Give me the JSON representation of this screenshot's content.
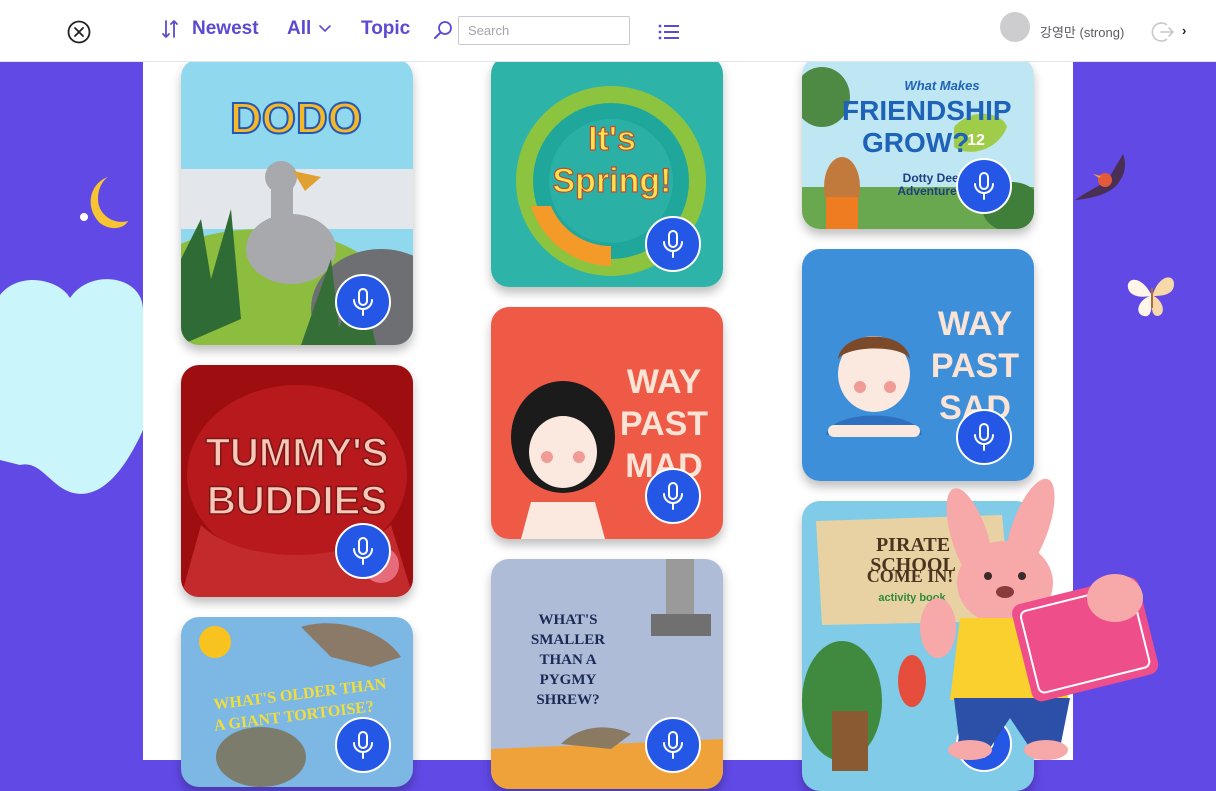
{
  "toolbar": {
    "sort_label": "Newest",
    "filter_label": "All",
    "topic_label": "Topic",
    "search_placeholder": "Search",
    "search_value": ""
  },
  "user": {
    "name": "강영만 (strong)"
  },
  "icons": {
    "close": "close-circle-icon",
    "sort": "sort-arrows-icon",
    "filter": "chevron-down-icon",
    "search": "magnifier-icon",
    "view": "list-view-icon",
    "logout": "logout-icon",
    "next": "chevron-right-icon",
    "mic": "microphone-icon"
  },
  "colors": {
    "accent": "#5b4bd1",
    "background": "#6149e6",
    "mic_button": "#2457e6"
  },
  "books": [
    {
      "title_lines": [
        "DODO"
      ]
    },
    {
      "title_lines": [
        "It's",
        "Spring!"
      ]
    },
    {
      "title_lines": [
        "What Makes",
        "FRIENDSHIP",
        "GROW?",
        "12",
        "Dotty Deer",
        "Adventure"
      ]
    },
    {
      "title_lines": [
        "TUMMY'S",
        "BUDDIES"
      ]
    },
    {
      "title_lines": [
        "WAY",
        "PAST",
        "MAD"
      ]
    },
    {
      "title_lines": [
        "WAY",
        "PAST",
        "SAD"
      ]
    },
    {
      "title_lines": [
        "WHAT'S OLDER THAN",
        "A GIANT TORTOISE?"
      ]
    },
    {
      "title_lines": [
        "WHAT'S",
        "SMALLER",
        "THAN A",
        "PYGMY",
        "SHREW?"
      ]
    },
    {
      "title_lines": [
        "PIRATE SCHOOL",
        "COME IN!",
        "activity book"
      ]
    }
  ]
}
